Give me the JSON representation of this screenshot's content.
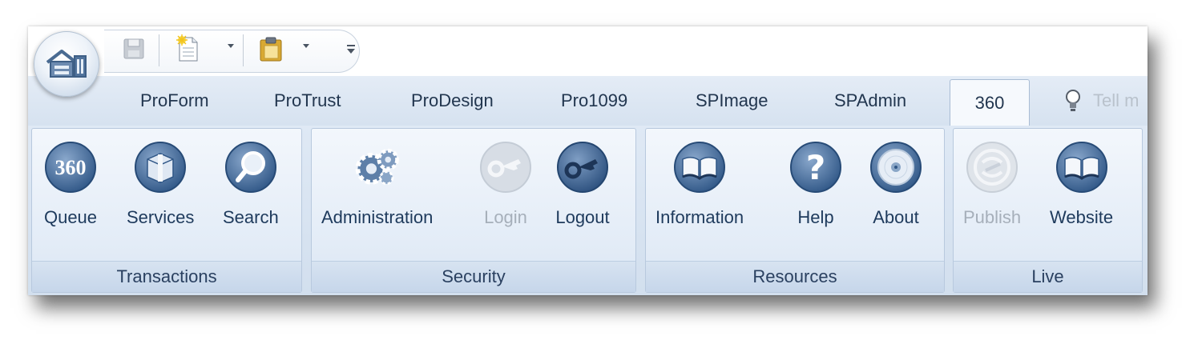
{
  "quick_access": {
    "items": [
      {
        "name": "save",
        "icon": "floppy-disk-icon",
        "enabled": false
      },
      {
        "name": "new",
        "icon": "new-document-icon",
        "has_dropdown": true
      },
      {
        "name": "paste",
        "icon": "clipboard-icon",
        "has_dropdown": true
      }
    ]
  },
  "tabs": [
    {
      "label": "ProForm",
      "active": false
    },
    {
      "label": "ProTrust",
      "active": false
    },
    {
      "label": "ProDesign",
      "active": false
    },
    {
      "label": "Pro1099",
      "active": false
    },
    {
      "label": "SPImage",
      "active": false
    },
    {
      "label": "SPAdmin",
      "active": false
    },
    {
      "label": "360",
      "active": true
    }
  ],
  "tell_me": {
    "text": "Tell m"
  },
  "groups": [
    {
      "label": "Transactions",
      "buttons": [
        {
          "label": "Queue",
          "icon": "360-icon",
          "enabled": true
        },
        {
          "label": "Services",
          "icon": "box-icon",
          "enabled": true
        },
        {
          "label": "Search",
          "icon": "magnifier-icon",
          "enabled": true
        }
      ]
    },
    {
      "label": "Security",
      "buttons": [
        {
          "label": "Administration",
          "icon": "gears-icon",
          "enabled": true
        },
        {
          "label": "Login",
          "icon": "key-icon",
          "enabled": false
        },
        {
          "label": "Logout",
          "icon": "key-icon",
          "enabled": true
        }
      ]
    },
    {
      "label": "Resources",
      "buttons": [
        {
          "label": "Information",
          "icon": "book-icon",
          "enabled": true
        },
        {
          "label": "Help",
          "icon": "question-mark-icon",
          "enabled": true
        },
        {
          "label": "About",
          "icon": "disc-icon",
          "enabled": true
        }
      ]
    },
    {
      "label": "Live",
      "buttons": [
        {
          "label": "Publish",
          "icon": "publish-icon",
          "enabled": false
        },
        {
          "label": "Website",
          "icon": "book-icon",
          "enabled": true
        }
      ]
    }
  ],
  "colors": {
    "accent": "#3f6aa0",
    "icon_dark": "#2e5584",
    "ribbon_bg": "#dfe9f5",
    "text": "#1e3a5c",
    "disabled": "#a6afba"
  }
}
